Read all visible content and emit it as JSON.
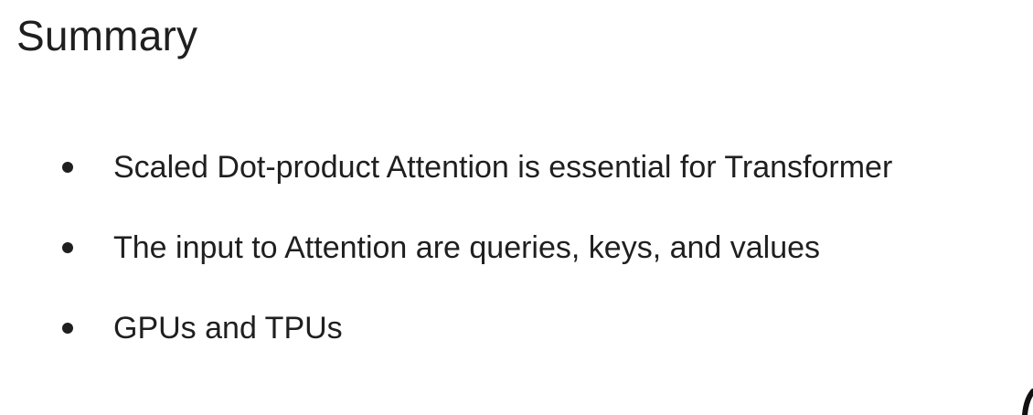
{
  "slide": {
    "title": "Summary",
    "bullets": [
      "Scaled Dot-product Attention is essential for Transformer",
      "The input to Attention are queries, keys, and values",
      "GPUs and TPUs"
    ]
  }
}
